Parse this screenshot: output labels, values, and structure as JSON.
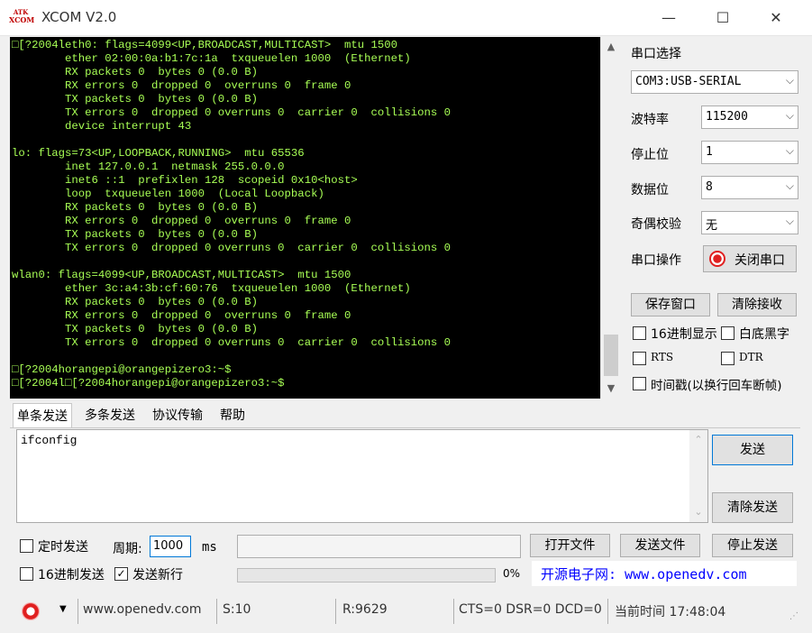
{
  "window": {
    "logo_top": "ATK",
    "logo_bottom": "XCOM",
    "title": "XCOM V2.0",
    "minimize": "—",
    "maximize": "☐",
    "close": "✕"
  },
  "terminal": {
    "lines": "□[?2004leth0: flags=4099<UP,BROADCAST,MULTICAST>  mtu 1500\n        ether 02:00:0a:b1:7c:1a  txqueuelen 1000  (Ethernet)\n        RX packets 0  bytes 0 (0.0 B)\n        RX errors 0  dropped 0  overruns 0  frame 0\n        TX packets 0  bytes 0 (0.0 B)\n        TX errors 0  dropped 0 overruns 0  carrier 0  collisions 0\n        device interrupt 43\n\nlo: flags=73<UP,LOOPBACK,RUNNING>  mtu 65536\n        inet 127.0.0.1  netmask 255.0.0.0\n        inet6 ::1  prefixlen 128  scopeid 0x10<host>\n        loop  txqueuelen 1000  (Local Loopback)\n        RX packets 0  bytes 0 (0.0 B)\n        RX errors 0  dropped 0  overruns 0  frame 0\n        TX packets 0  bytes 0 (0.0 B)\n        TX errors 0  dropped 0 overruns 0  carrier 0  collisions 0\n\nwlan0: flags=4099<UP,BROADCAST,MULTICAST>  mtu 1500\n        ether 3c:a4:3b:cf:60:76  txqueuelen 1000  (Ethernet)\n        RX packets 0  bytes 0 (0.0 B)\n        RX errors 0  dropped 0  overruns 0  frame 0\n        TX packets 0  bytes 0 (0.0 B)\n        TX errors 0  dropped 0 overruns 0  carrier 0  collisions 0\n\n□[?2004horangepi@orangepizero3:~$\n□[?2004l□[?2004horangepi@orangepizero3:~$"
  },
  "serial": {
    "port_label": "串口选择",
    "port_value": "COM3:USB-SERIAL",
    "baud_label": "波特率",
    "baud_value": "115200",
    "stop_label": "停止位",
    "stop_value": "1",
    "data_label": "数据位",
    "data_value": "8",
    "parity_label": "奇偶校验",
    "parity_value": "无",
    "op_label": "串口操作",
    "close_port_button": "关闭串口"
  },
  "receive": {
    "save_button": "保存窗口",
    "clear_button": "清除接收",
    "hex_display": "16进制显示",
    "white_black": "白底黑字",
    "rts": "RTS",
    "dtr": "DTR",
    "timestamp": "时间戳(以换行回车断帧)"
  },
  "tabs": [
    "单条发送",
    "多条发送",
    "协议传输",
    "帮助"
  ],
  "send": {
    "text": "ifconfig",
    "send_button": "发送",
    "clear_send_button": "清除发送",
    "timed_send": "定时发送",
    "period_label": "周期:",
    "period_value": "1000",
    "period_unit": "ms",
    "hex_send": "16进制发送",
    "newline": "发送新行",
    "open_file_button": "打开文件",
    "send_file_button": "发送文件",
    "stop_send_button": "停止发送",
    "progress_percent": "0%",
    "progress_value": 0,
    "promo": "开源电子网: www.openedv.com"
  },
  "status": {
    "site": "www.openedv.com",
    "sent": "S:10",
    "received": "R:9629",
    "lines": "CTS=0 DSR=0 DCD=0",
    "time": "当前时间 17:48:04"
  },
  "colors": {
    "terminal_bg": "#000000",
    "terminal_fg": "#a8ff55",
    "promo_blue": "#0000ff",
    "record_red": "#e02020"
  }
}
